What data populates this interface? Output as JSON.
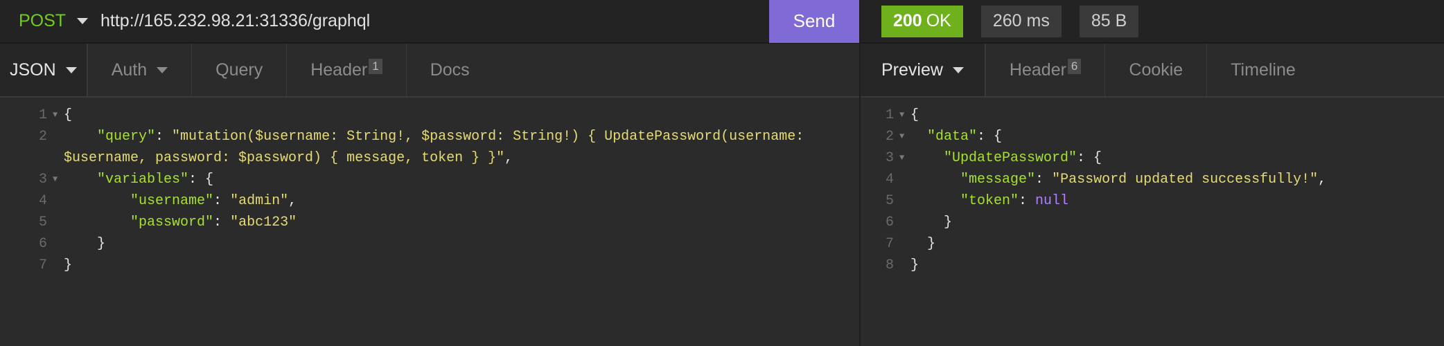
{
  "request": {
    "method": "POST",
    "url": "http://165.232.98.21:31336/graphql",
    "send_label": "Send",
    "tabs": [
      {
        "label": "JSON"
      },
      {
        "label": "Auth"
      },
      {
        "label": "Query"
      },
      {
        "label": "Header",
        "badge": "1"
      },
      {
        "label": "Docs"
      }
    ],
    "line_numbers": [
      "1",
      "2",
      "",
      "3",
      "4",
      "5",
      "6",
      "7"
    ]
  },
  "response": {
    "status_code": "200",
    "status_text": "OK",
    "time": "260 ms",
    "size": "85 B",
    "tabs": [
      {
        "label": "Preview"
      },
      {
        "label": "Header",
        "badge": "6"
      },
      {
        "label": "Cookie"
      },
      {
        "label": "Timeline"
      }
    ],
    "line_numbers": [
      "1",
      "2",
      "3",
      "4",
      "5",
      "6",
      "7",
      "8"
    ]
  },
  "req_code": {
    "l1": "{",
    "l2_key": "\"query\"",
    "l2_val_a": "\"mutation($username: String!, $password: String!) { UpdatePassword(username:",
    "l2_val_b": "$username, password: $password) { message, token } }\"",
    "l3_key": "\"variables\"",
    "l3_open": ": {",
    "l4_key": "\"username\"",
    "l4_val": "\"admin\"",
    "l5_key": "\"password\"",
    "l5_val": "\"abc123\"",
    "l6": "}",
    "l7": "}"
  },
  "res_code": {
    "l1": "{",
    "l2_key": "\"data\"",
    "l3_key": "\"UpdatePassword\"",
    "l4_key": "\"message\"",
    "l4_val": "\"Password updated successfully!\"",
    "l5_key": "\"token\"",
    "l5_val": "null",
    "l6": "}",
    "l7": "}",
    "l8": "}"
  },
  "colors": {
    "method": "#6fcf1c",
    "send": "#7f6ad6",
    "status_ok": "#6eb11d",
    "json_key": "#a6e22e",
    "json_string": "#e6db74",
    "json_null": "#ae81ff"
  }
}
